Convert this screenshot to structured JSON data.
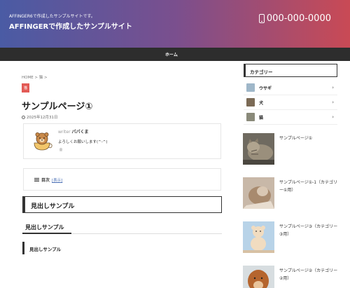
{
  "header": {
    "tagline": "AFFINGER6で作成したサンプルサイトです。",
    "site_title": "AFFINGERで作成したサンプルサイト",
    "phone": "000-000-0000",
    "phone_icon": "smartphone-icon"
  },
  "nav": {
    "items": [
      "ホーム"
    ]
  },
  "main": {
    "breadcrumb": "HOME > 猫 >",
    "category": "猫",
    "title": "サンプルページ①",
    "date": "2025年12月31日",
    "author": {
      "writer_label": "writer",
      "name": "パパくま",
      "message": "よろしくお願いします(^-^)"
    },
    "toc": {
      "label": "目次",
      "toggle": "[表示]"
    },
    "h2": "見出しサンプル",
    "h3": "見出しサンプル",
    "h4": "見出しサンプル"
  },
  "sidebar": {
    "heading": "カテゴリー",
    "categories": [
      {
        "label": "ウサギ",
        "thumb_color": "#9fb7c9"
      },
      {
        "label": "犬",
        "thumb_color": "#7b6a55"
      },
      {
        "label": "猫",
        "thumb_color": "#8a8a7a"
      }
    ],
    "posts": [
      {
        "title": "サンプルページ①"
      },
      {
        "title": "サンプルページ①-1（カテゴリー①用）"
      },
      {
        "title": "サンプルページ③（カテゴリー③用）"
      },
      {
        "title": "サンプルページ②（カテゴリー②用）"
      }
    ]
  },
  "colors": {
    "header_gradient": [
      "#4a5ba4",
      "#7a4f8e",
      "#c94a55"
    ],
    "nav_bg": "#2d2d2d",
    "category_badge": "#e25a55"
  }
}
